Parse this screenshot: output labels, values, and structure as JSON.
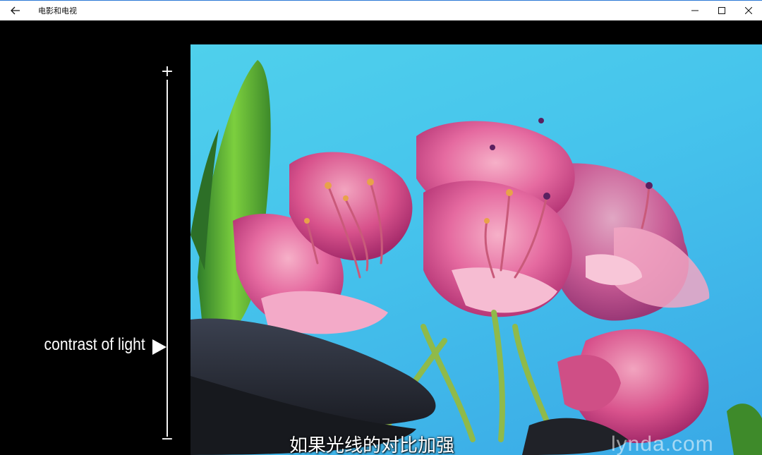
{
  "window": {
    "title": "电影和电视",
    "back_icon": "back-arrow-icon",
    "controls": [
      "minimize-icon",
      "maximize-icon",
      "close-icon"
    ]
  },
  "scale": {
    "plus": "+",
    "minus": "−",
    "label": "contrast of light",
    "pointer_icon": "triangle-right-icon"
  },
  "video": {
    "subtitle": "如果光线的对比加强",
    "watermark": "lynda.com"
  },
  "colors": {
    "titlebar_bg": "#ffffff",
    "titlebar_border": "#2b78d6",
    "background": "#000000",
    "sky": "#46c4ec",
    "petal": "#e0609a"
  }
}
